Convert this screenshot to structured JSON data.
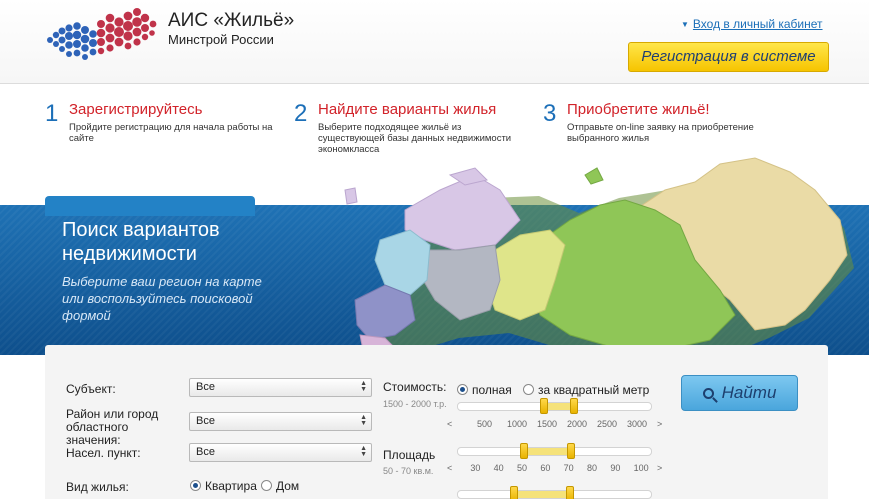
{
  "header": {
    "title": "АИС «Жильё»",
    "subtitle": "Минстрой России",
    "cabinet_link": "Вход в личный кабинет",
    "register_button": "Регистрация в системе"
  },
  "steps": [
    {
      "number": "1",
      "title": "Зарегистрируйтесь",
      "text": "Пройдите регистрацию для начала работы на сайте"
    },
    {
      "number": "2",
      "title": "Найдите варианты жилья",
      "text": "Выберите подходящее жильё из существующей базы данных недвижимости экономкласса"
    },
    {
      "number": "3",
      "title": "Приобретите жильё!",
      "text": "Отправьте on-line заявку на приобретение выбранного жилья"
    }
  ],
  "banner": {
    "title": "Поиск вариантов недвижимости",
    "subtitle": "Выберите ваш регион на карте или воспользуйтесь поисковой формой"
  },
  "form": {
    "subject_label": "Субъект:",
    "subject_value": "Все",
    "district_label": "Район или город областного значения:",
    "district_value": "Все",
    "locality_label": "Насел. пункт:",
    "locality_value": "Все",
    "housing_label": "Вид жилья:",
    "housing_opt1": "Квартира",
    "housing_opt2": "Дом",
    "cost_label": "Стоимость:",
    "cost_hint": "1500 - 2000 т.р.",
    "cost_opt1": "полная",
    "cost_opt2": "за квадратный метр",
    "cost_range": [
      1500,
      2000
    ],
    "cost_ticks": [
      "<",
      "500",
      "1000",
      "1500",
      "2000",
      "2500",
      "3000",
      ">"
    ],
    "area_label": "Площадь",
    "area_hint": "50 - 70 кв.м.",
    "area_range": [
      50,
      70
    ],
    "area_ticks": [
      "<",
      "30",
      "40",
      "50",
      "60",
      "70",
      "80",
      "90",
      "100",
      ">"
    ],
    "find_button": "Найти"
  },
  "colors": {
    "brand_blue": "#1c6fb8",
    "step_red": "#d2232a",
    "register_yellow": "#f6c400",
    "banner_blue": "#1f72b5",
    "find_blue": "#4aa6dc"
  }
}
